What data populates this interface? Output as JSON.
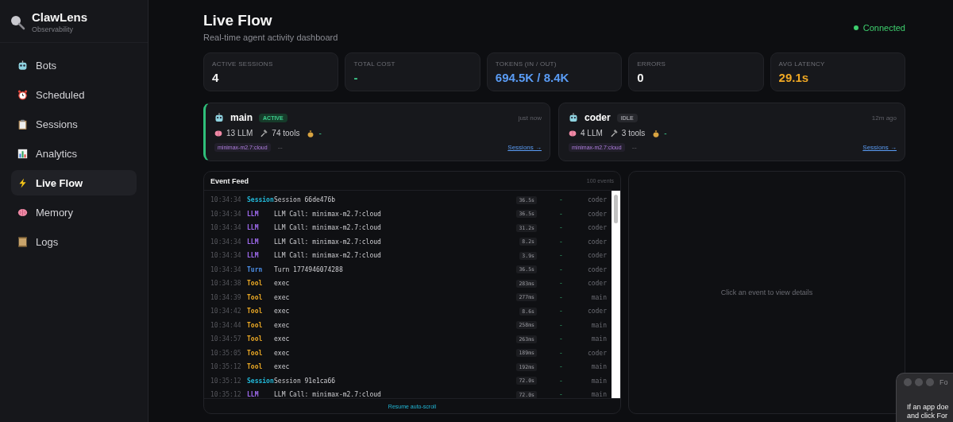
{
  "brand": {
    "title": "ClawLens",
    "subtitle": "Observability"
  },
  "nav": [
    {
      "label": "Bots",
      "kind": "robot",
      "selected": false
    },
    {
      "label": "Scheduled",
      "kind": "clock",
      "selected": false
    },
    {
      "label": "Sessions",
      "kind": "clipboard",
      "selected": false
    },
    {
      "label": "Analytics",
      "kind": "chart",
      "selected": false
    },
    {
      "label": "Live Flow",
      "kind": "bolt",
      "selected": true
    },
    {
      "label": "Memory",
      "kind": "brain",
      "selected": false
    },
    {
      "label": "Logs",
      "kind": "scroll",
      "selected": false
    }
  ],
  "header": {
    "title": "Live Flow",
    "subtitle": "Real-time agent activity dashboard",
    "status": "Connected",
    "connected": true
  },
  "stats": [
    {
      "label": "ACTIVE SESSIONS",
      "value": "4",
      "kind": "plain"
    },
    {
      "label": "TOTAL COST",
      "value": "-",
      "kind": "cost"
    },
    {
      "label": "TOKENS (IN / OUT)",
      "value": "694.5K / 8.4K",
      "kind": "tokens"
    },
    {
      "label": "ERRORS",
      "value": "0",
      "kind": "plain"
    },
    {
      "label": "AVG LATENCY",
      "value": "29.1s",
      "kind": "latency"
    }
  ],
  "agents": [
    {
      "name": "main",
      "status": "ACTIVE",
      "active": true,
      "time": "just now",
      "llm": "13 LLM",
      "tools": "74 tools",
      "cost": "-",
      "model": "minimax-m2.7:cloud",
      "extra": "--",
      "link": "Sessions →"
    },
    {
      "name": "coder",
      "status": "IDLE",
      "active": false,
      "time": "12m ago",
      "llm": "4 LLM",
      "tools": "3 tools",
      "cost": "-",
      "model": "minimax-m2.7:cloud",
      "extra": "--",
      "link": "Sessions →"
    }
  ],
  "feed": {
    "title": "Event Feed",
    "count": "100 events",
    "resume": "Resume auto-scroll",
    "events": [
      {
        "time": "10:34:34",
        "type": "Session",
        "kind": "session",
        "message": "Session 66de476b",
        "duration": "36.5s",
        "cost": "-",
        "agent": "coder"
      },
      {
        "time": "10:34:34",
        "type": "LLM",
        "kind": "llm",
        "message": "LLM Call: minimax-m2.7:cloud",
        "duration": "36.5s",
        "cost": "-",
        "agent": "coder"
      },
      {
        "time": "10:34:34",
        "type": "LLM",
        "kind": "llm",
        "message": "LLM Call: minimax-m2.7:cloud",
        "duration": "31.2s",
        "cost": "-",
        "agent": "coder"
      },
      {
        "time": "10:34:34",
        "type": "LLM",
        "kind": "llm",
        "message": "LLM Call: minimax-m2.7:cloud",
        "duration": "8.2s",
        "cost": "-",
        "agent": "coder"
      },
      {
        "time": "10:34:34",
        "type": "LLM",
        "kind": "llm",
        "message": "LLM Call: minimax-m2.7:cloud",
        "duration": "3.9s",
        "cost": "-",
        "agent": "coder"
      },
      {
        "time": "10:34:34",
        "type": "Turn",
        "kind": "turn",
        "message": "Turn 1774946074288",
        "duration": "36.5s",
        "cost": "-",
        "agent": "coder"
      },
      {
        "time": "10:34:38",
        "type": "Tool",
        "kind": "tool",
        "message": "exec",
        "duration": "283ms",
        "cost": "-",
        "agent": "coder"
      },
      {
        "time": "10:34:39",
        "type": "Tool",
        "kind": "tool",
        "message": "exec",
        "duration": "277ms",
        "cost": "-",
        "agent": "main"
      },
      {
        "time": "10:34:42",
        "type": "Tool",
        "kind": "tool",
        "message": "exec",
        "duration": "8.6s",
        "cost": "-",
        "agent": "coder"
      },
      {
        "time": "10:34:44",
        "type": "Tool",
        "kind": "tool",
        "message": "exec",
        "duration": "258ms",
        "cost": "-",
        "agent": "main"
      },
      {
        "time": "10:34:57",
        "type": "Tool",
        "kind": "tool",
        "message": "exec",
        "duration": "263ms",
        "cost": "-",
        "agent": "main"
      },
      {
        "time": "10:35:05",
        "type": "Tool",
        "kind": "tool",
        "message": "exec",
        "duration": "189ms",
        "cost": "-",
        "agent": "coder"
      },
      {
        "time": "10:35:12",
        "type": "Tool",
        "kind": "tool",
        "message": "exec",
        "duration": "192ms",
        "cost": "-",
        "agent": "main"
      },
      {
        "time": "10:35:12",
        "type": "Session",
        "kind": "session",
        "message": "Session 91e1ca66",
        "duration": "72.0s",
        "cost": "-",
        "agent": "main"
      },
      {
        "time": "10:35:12",
        "type": "LLM",
        "kind": "llm",
        "message": "LLM Call: minimax-m2.7:cloud",
        "duration": "72.0s",
        "cost": "-",
        "agent": "main"
      }
    ]
  },
  "details": {
    "empty": "Click an event to view details"
  },
  "popup": {
    "title": "Fo",
    "lines": [
      "If an app doe",
      "and click For"
    ]
  }
}
